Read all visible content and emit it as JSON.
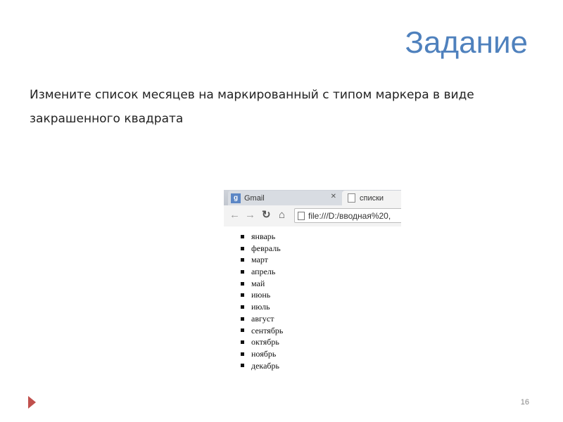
{
  "slide": {
    "title": "Задание",
    "task": "Измените список месяцев на маркированный с типом маркера в виде закрашенного квадрата",
    "page_number": "16"
  },
  "browser": {
    "tabs": [
      {
        "label": "Gmail",
        "icon": "gmail-icon"
      },
      {
        "label": "списки",
        "icon": "page-icon"
      }
    ],
    "url": "file:///D:/вводная%20,"
  },
  "list": {
    "marker": "filled-square",
    "items": [
      "январь",
      "февраль",
      "март",
      "апрель",
      "май",
      "июнь",
      "июль",
      "август",
      "сентябрь",
      "октябрь",
      "ноябрь",
      "декабрь"
    ]
  },
  "colors": {
    "title": "#4f81bd",
    "arrow": "#c0504d"
  }
}
